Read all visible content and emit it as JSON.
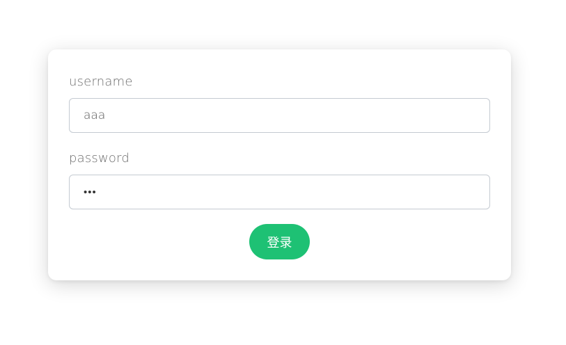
{
  "form": {
    "username_label": "username",
    "username_value": "aaa",
    "password_label": "password",
    "password_value": "aaa",
    "submit_label": "登录"
  },
  "colors": {
    "accent": "#1ec174",
    "label_text": "#6e6e6e",
    "input_border": "#c4cad1"
  }
}
